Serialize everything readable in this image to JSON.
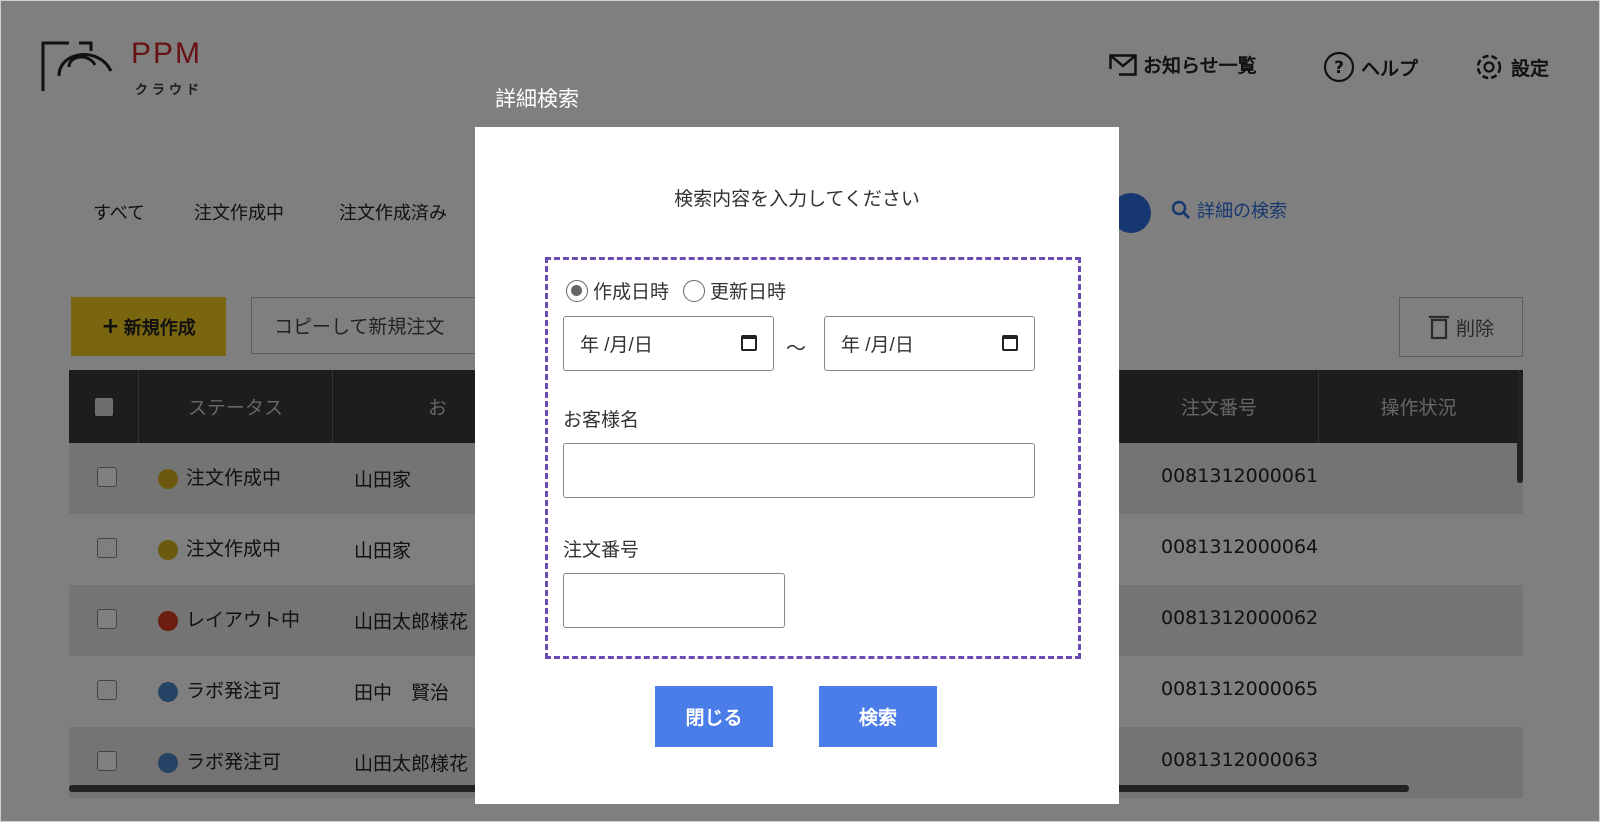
{
  "header": {
    "logo_text": "PPM",
    "logo_sub": "クラウド",
    "notifications": "お知らせ一覧",
    "help": "ヘルプ",
    "settings": "設定"
  },
  "tabs": [
    "すべて",
    "注文作成中",
    "注文作成済み"
  ],
  "detail_search_link": "詳細の検索",
  "toolbar": {
    "new_label": "新規作成",
    "copy_label": "コピーして新規注文",
    "delete_label": "削除"
  },
  "table": {
    "columns": {
      "status": "ステータス",
      "customer": "お",
      "order_no": "注文番号",
      "operation": "操作状況"
    },
    "rows": [
      {
        "status": "注文作成中",
        "status_color": "#d9b21f",
        "customer": "山田家",
        "order_no": "0081312000061"
      },
      {
        "status": "注文作成中",
        "status_color": "#d9b21f",
        "customer": "山田家",
        "order_no": "0081312000064"
      },
      {
        "status": "レイアウト中",
        "status_color": "#d83a1a",
        "customer": "山田太郎様花",
        "order_no": "0081312000062"
      },
      {
        "status": "ラボ発注可",
        "status_color": "#4a86c8",
        "customer": "田中　賢治",
        "order_no": "0081312000065"
      },
      {
        "status": "ラボ発注可",
        "status_color": "#4a86c8",
        "customer": "山田太郎様花",
        "order_no": "0081312000063"
      }
    ]
  },
  "modal": {
    "title": "詳細検索",
    "intro": "検索内容を入力してください",
    "radio_created": "作成日時",
    "radio_updated": "更新日時",
    "date_from_placeholder": "年 /月/日",
    "date_to_placeholder": "年 /月/日",
    "range_separator": "～",
    "customer_label": "お客様名",
    "customer_value": "",
    "order_label": "注文番号",
    "order_value": "",
    "close_label": "閉じる",
    "search_label": "検索"
  },
  "colors": {
    "accent": "#4a7de8",
    "new_button": "#f2cd1c",
    "dashed_border": "#6a4bb3",
    "brand": "#d1252a"
  }
}
